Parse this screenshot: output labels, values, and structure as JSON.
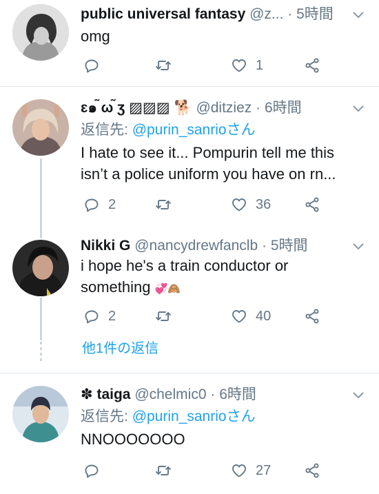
{
  "colors": {
    "accent": "#1da1f2",
    "secondary": "#657786",
    "divider": "#e1e8ed"
  },
  "tweets": [
    {
      "name": "public universal fantasy",
      "handle": "@z...",
      "time": "5時間",
      "text": "omg",
      "replies": "",
      "retweets": "",
      "likes": "1"
    },
    {
      "name": "ɛ๑ ̃ω ̃ʒ ▨▨▨",
      "name_emoji": "🐕",
      "handle": "@ditziez",
      "time": "6時間",
      "reply_prefix": "返信先:",
      "reply_to": "@purin_sanrioさん",
      "text": "I hate to see it... Pompurin tell me this isn’t a police uniform you have on rn...",
      "replies": "2",
      "retweets": "",
      "likes": "36"
    },
    {
      "name": "Nikki G",
      "handle": "@nancydrewfanclb",
      "time": "5時間",
      "text": "i hope he's a train conductor or something",
      "text_emoji": "💞🙈",
      "replies": "2",
      "retweets": "",
      "likes": "40",
      "more_replies": "他1件の返信"
    },
    {
      "name_prefix": "✽",
      "name": "taiga",
      "handle": "@chelmic0",
      "time": "6時間",
      "reply_prefix": "返信先:",
      "reply_to": "@purin_sanrioさん",
      "text": "NNOOOOOOO",
      "replies": "",
      "retweets": "",
      "likes": "27"
    }
  ],
  "separator": "·",
  "icons": [
    "reply-icon",
    "retweet-icon",
    "like-icon",
    "share-icon",
    "caret-down-icon"
  ]
}
